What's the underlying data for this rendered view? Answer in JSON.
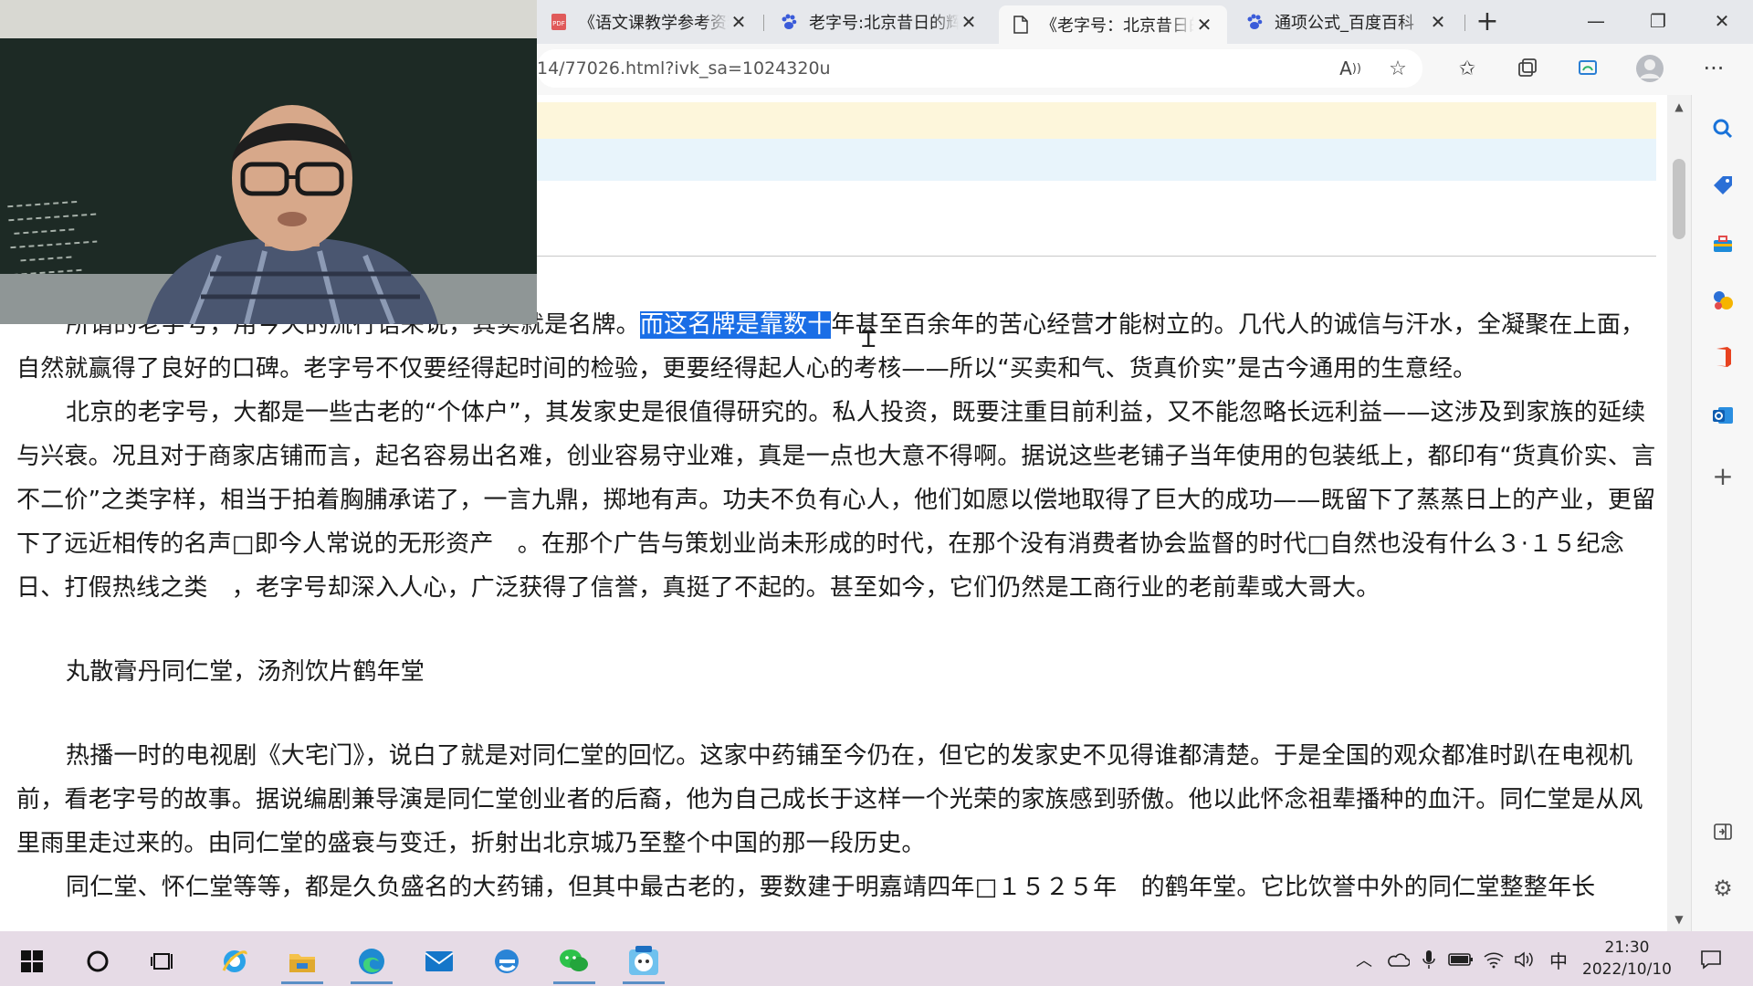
{
  "browser": {
    "tabs": [
      {
        "title": "《语文课教学参考资料》",
        "icon": "pdf-icon",
        "active": false
      },
      {
        "title": "老字号:北京昔日的辉煌",
        "icon": "baidu-paw-icon",
        "active": false
      },
      {
        "title": "《老字号：北京昔日的辉煌》",
        "icon": "page-icon",
        "active": true
      },
      {
        "title": "通项公式_百度百科",
        "icon": "baidu-paw-icon",
        "active": false
      }
    ],
    "address": "14/77026.html?ivk_sa=1024320u"
  },
  "article": {
    "p1_before": "所谓的老字号，用今天的流行语来说，其实就是名牌。",
    "p1_selected": "而这名牌是靠数十",
    "p1_after": "年甚至百余年的苦心经营才能树立的。几代人的诚信与汗水，全凝聚在上面，自然就赢得了良好的口碑。老字号不仅要经得起时间的检验，更要经得起人心的考核——所以“买卖和气、货真价实”是古今通用的生意经。",
    "p2": "北京的老字号，大都是一些古老的“个体户”，其发家史是很值得研究的。私人投资，既要注重目前利益，又不能忽略长远利益——这涉及到家族的延续与兴衰。况且对于商家店铺而言，起名容易出名难，创业容易守业难，真是一点也大意不得啊。据说这些老铺子当年使用的包装纸上，都印有“货真价实、言不二价”之类字样，相当于拍着胸脯承诺了，一言九鼎，掷地有声。功夫不负有心人，他们如愿以偿地取得了巨大的成功——既留下了蒸蒸日上的产业，更留下了远近相传的名声□即今人常说的无形资产　。在那个广告与策划业尚未形成的时代，在那个没有消费者协会监督的时代□自然也没有什么３·１５纪念日、打假热线之类　，老字号却深入人心，广泛获得了信誉，真挺了不起的。甚至如今，它们仍然是工商行业的老前辈或大哥大。",
    "heading": "丸散膏丹同仁堂，汤剂饮片鹤年堂",
    "p3": "热播一时的电视剧《大宅门》，说白了就是对同仁堂的回忆。这家中药铺至今仍在，但它的发家史不见得谁都清楚。于是全国的观众都准时趴在电视机前，看老字号的故事。据说编剧兼导演是同仁堂创业者的后裔，他为自己成长于这样一个光荣的家族感到骄傲。他以此怀念祖辈播种的血汗。同仁堂是从风里雨里走过来的。由同仁堂的盛衰与变迁，折射出北京城乃至整个中国的那一段历史。",
    "p4_partial": "同仁堂、怀仁堂等等，都是久负盛名的大药铺，但其中最古老的，要数建于明嘉靖四年□１５２５年　的鹤年堂。它比饮誉中外的同仁堂整整年长"
  },
  "taskbar": {
    "clock_time": "21:30",
    "clock_date": "2022/10/10",
    "ime": "中"
  },
  "colors": {
    "selection": "#1a6ee6",
    "taskbar": "#e6dbe6",
    "tabstrip": "#e6e8ec"
  }
}
